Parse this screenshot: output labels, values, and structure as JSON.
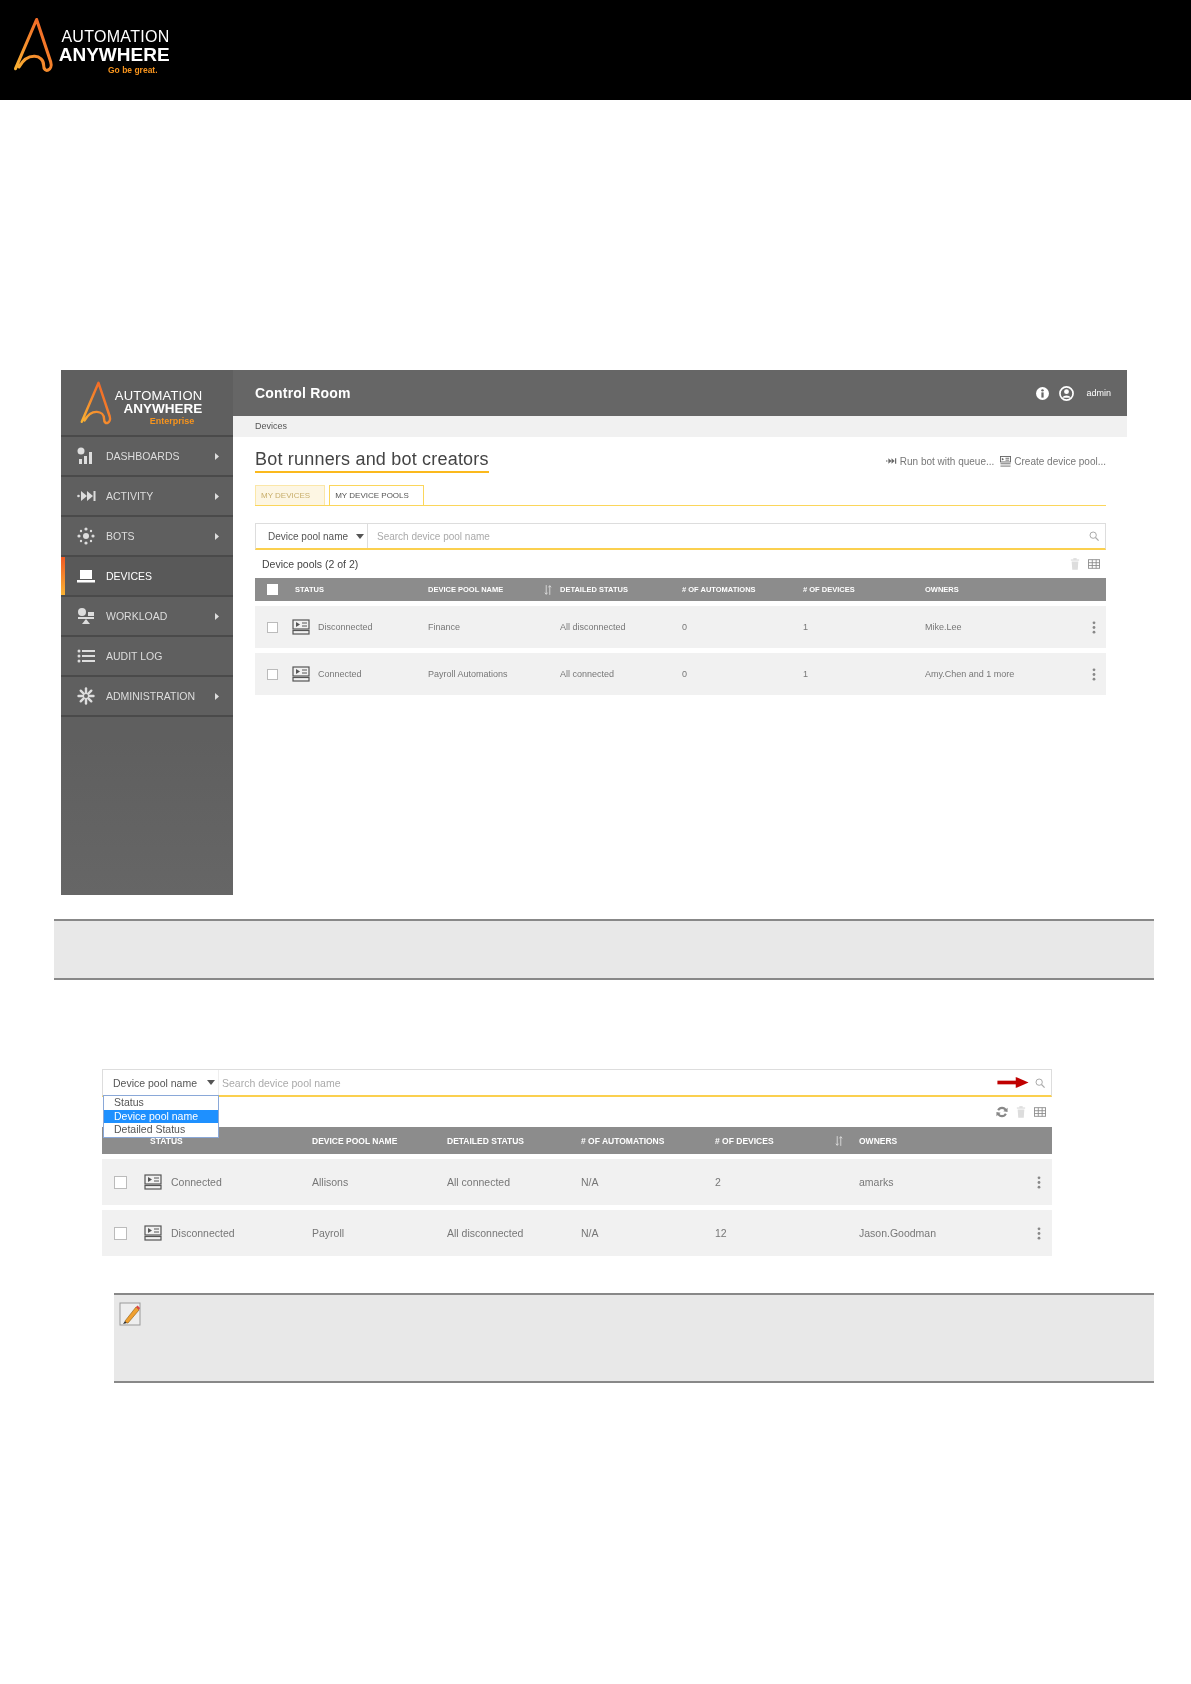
{
  "header": {
    "logo": {
      "line1": "AUTOMATION",
      "line2": "ANYWHERE",
      "tagline": "Go be great."
    }
  },
  "screenshot_1": {
    "sidebar": {
      "logo": {
        "line1": "AUTOMATION",
        "line2": "ANYWHERE",
        "edition": "Enterprise"
      },
      "items": [
        {
          "label": "DASHBOARDS",
          "kind": "dashboard",
          "submenu": true,
          "selected": false
        },
        {
          "label": "ACTIVITY",
          "kind": "activity",
          "submenu": true,
          "selected": false
        },
        {
          "label": "BOTS",
          "kind": "bots",
          "submenu": true,
          "selected": false
        },
        {
          "label": "DEVICES",
          "kind": "devices",
          "submenu": false,
          "selected": true
        },
        {
          "label": "WORKLOAD",
          "kind": "workload",
          "submenu": true,
          "selected": false
        },
        {
          "label": "AUDIT LOG",
          "kind": "audit",
          "submenu": false,
          "selected": false
        },
        {
          "label": "ADMINISTRATION",
          "kind": "admin",
          "submenu": true,
          "selected": false
        }
      ]
    },
    "topbar": {
      "title": "Control Room",
      "user": "admin"
    },
    "breadcrumb": "Devices",
    "page_title": "Bot runners and bot creators",
    "actions": [
      {
        "kind": "run",
        "label": "Run bot with queue..."
      },
      {
        "kind": "create",
        "label": "Create device pool..."
      }
    ],
    "tabs": [
      {
        "label": "MY DEVICES",
        "selected": false
      },
      {
        "label": "MY DEVICE POOLS",
        "selected": true
      }
    ],
    "search": {
      "filter": "Device pool name",
      "placeholder": "Search device pool name"
    },
    "count": "Device pools (2 of 2)",
    "tools": [
      {
        "kind": "delete",
        "disabled": true
      },
      {
        "kind": "columns",
        "disabled": false
      }
    ],
    "table": {
      "header_checked": false,
      "columns": [
        {
          "label": "STATUS",
          "sorted": false
        },
        {
          "label": "DEVICE POOL NAME",
          "sorted": true
        },
        {
          "label": "DETAILED STATUS",
          "sorted": false
        },
        {
          "label": "# OF AUTOMATIONS",
          "sorted": false
        },
        {
          "label": "# OF DEVICES",
          "sorted": false
        },
        {
          "label": "OWNERS",
          "sorted": false
        }
      ],
      "rows": [
        {
          "checked": false,
          "cells": [
            "Disconnected",
            "Finance",
            "All disconnected",
            "0",
            "1",
            "Mike.Lee"
          ]
        },
        {
          "checked": false,
          "cells": [
            "Connected",
            "Payroll Automations",
            "All connected",
            "0",
            "1",
            "Amy.Chen and 1 more"
          ]
        }
      ]
    }
  },
  "screenshot_2": {
    "search": {
      "filter": "Device pool name",
      "placeholder": "Search device pool name"
    },
    "dropdown": {
      "options": [
        {
          "label": "Status",
          "selected": false
        },
        {
          "label": "Device pool name",
          "selected": true
        },
        {
          "label": "Detailed Status",
          "selected": false
        }
      ]
    },
    "tools": [
      {
        "kind": "refresh",
        "disabled": false
      },
      {
        "kind": "delete",
        "disabled": true
      },
      {
        "kind": "columns",
        "disabled": false
      }
    ],
    "table": {
      "columns": [
        {
          "label": "STATUS",
          "sorted": false
        },
        {
          "label": "DEVICE POOL NAME",
          "sorted": false
        },
        {
          "label": "DETAILED STATUS",
          "sorted": false
        },
        {
          "label": "# OF AUTOMATIONS",
          "sorted": false
        },
        {
          "label": "# OF DEVICES",
          "sorted": true
        },
        {
          "label": "OWNERS",
          "sorted": false
        }
      ],
      "rows": [
        {
          "checked": false,
          "cells": [
            "Connected",
            "Allisons",
            "All connected",
            "N/A",
            "2",
            "amarks"
          ]
        },
        {
          "checked": false,
          "cells": [
            "Disconnected",
            "Payroll",
            "All disconnected",
            "N/A",
            "12",
            "Jason.Goodman"
          ]
        }
      ]
    }
  }
}
